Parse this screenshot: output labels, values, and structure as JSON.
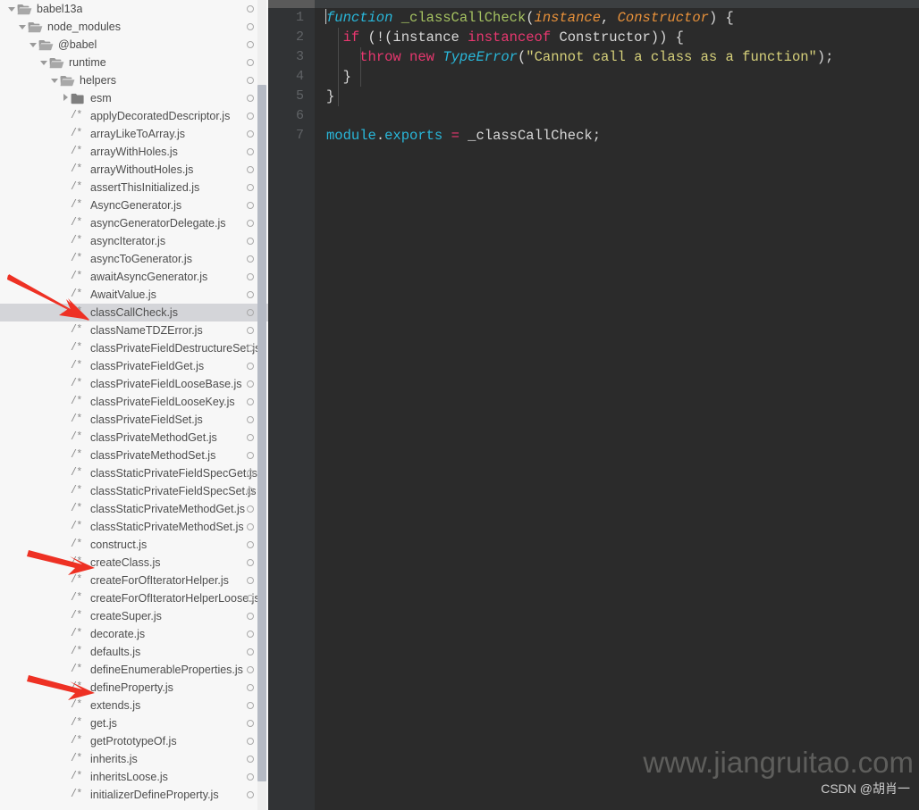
{
  "sidebar": {
    "scrollbar": {
      "name": "vertical-scrollbar"
    },
    "tree": [
      {
        "type": "folder",
        "depth": 1,
        "label": "babel13a",
        "expanded": true,
        "marker": "circle"
      },
      {
        "type": "folder",
        "depth": 2,
        "label": "node_modules",
        "expanded": true,
        "marker": "circle"
      },
      {
        "type": "folder",
        "depth": 3,
        "label": "@babel",
        "expanded": true,
        "marker": "circle"
      },
      {
        "type": "folder",
        "depth": 4,
        "label": "runtime",
        "expanded": true,
        "marker": "circle"
      },
      {
        "type": "folder",
        "depth": 5,
        "label": "helpers",
        "expanded": true,
        "marker": "circle"
      },
      {
        "type": "folder",
        "depth": 6,
        "label": "esm",
        "expanded": false,
        "marker": "circle",
        "closed": true
      },
      {
        "type": "file",
        "depth": 6,
        "label": "applyDecoratedDescriptor.js",
        "marker": "circle"
      },
      {
        "type": "file",
        "depth": 6,
        "label": "arrayLikeToArray.js",
        "marker": "circle"
      },
      {
        "type": "file",
        "depth": 6,
        "label": "arrayWithHoles.js",
        "marker": "circle"
      },
      {
        "type": "file",
        "depth": 6,
        "label": "arrayWithoutHoles.js",
        "marker": "circle"
      },
      {
        "type": "file",
        "depth": 6,
        "label": "assertThisInitialized.js",
        "marker": "circle"
      },
      {
        "type": "file",
        "depth": 6,
        "label": "AsyncGenerator.js",
        "marker": "circle"
      },
      {
        "type": "file",
        "depth": 6,
        "label": "asyncGeneratorDelegate.js",
        "marker": "circle"
      },
      {
        "type": "file",
        "depth": 6,
        "label": "asyncIterator.js",
        "marker": "circle"
      },
      {
        "type": "file",
        "depth": 6,
        "label": "asyncToGenerator.js",
        "marker": "circle"
      },
      {
        "type": "file",
        "depth": 6,
        "label": "awaitAsyncGenerator.js",
        "marker": "circle"
      },
      {
        "type": "file",
        "depth": 6,
        "label": "AwaitValue.js",
        "marker": "circle"
      },
      {
        "type": "file",
        "depth": 6,
        "label": "classCallCheck.js",
        "marker": "circle",
        "selected": true
      },
      {
        "type": "file",
        "depth": 6,
        "label": "classNameTDZError.js",
        "marker": "circle"
      },
      {
        "type": "file",
        "depth": 6,
        "label": "classPrivateFieldDestructureSet.js",
        "marker": "circle"
      },
      {
        "type": "file",
        "depth": 6,
        "label": "classPrivateFieldGet.js",
        "marker": "circle"
      },
      {
        "type": "file",
        "depth": 6,
        "label": "classPrivateFieldLooseBase.js",
        "marker": "circle"
      },
      {
        "type": "file",
        "depth": 6,
        "label": "classPrivateFieldLooseKey.js",
        "marker": "circle"
      },
      {
        "type": "file",
        "depth": 6,
        "label": "classPrivateFieldSet.js",
        "marker": "circle"
      },
      {
        "type": "file",
        "depth": 6,
        "label": "classPrivateMethodGet.js",
        "marker": "circle"
      },
      {
        "type": "file",
        "depth": 6,
        "label": "classPrivateMethodSet.js",
        "marker": "circle"
      },
      {
        "type": "file",
        "depth": 6,
        "label": "classStaticPrivateFieldSpecGet.js",
        "marker": "circle"
      },
      {
        "type": "file",
        "depth": 6,
        "label": "classStaticPrivateFieldSpecSet.js",
        "marker": "circle"
      },
      {
        "type": "file",
        "depth": 6,
        "label": "classStaticPrivateMethodGet.js",
        "marker": "circle"
      },
      {
        "type": "file",
        "depth": 6,
        "label": "classStaticPrivateMethodSet.js",
        "marker": "circle"
      },
      {
        "type": "file",
        "depth": 6,
        "label": "construct.js",
        "marker": "circle"
      },
      {
        "type": "file",
        "depth": 6,
        "label": "createClass.js",
        "marker": "circle"
      },
      {
        "type": "file",
        "depth": 6,
        "label": "createForOfIteratorHelper.js",
        "marker": "circle"
      },
      {
        "type": "file",
        "depth": 6,
        "label": "createForOfIteratorHelperLoose.js",
        "marker": "circle"
      },
      {
        "type": "file",
        "depth": 6,
        "label": "createSuper.js",
        "marker": "circle"
      },
      {
        "type": "file",
        "depth": 6,
        "label": "decorate.js",
        "marker": "circle"
      },
      {
        "type": "file",
        "depth": 6,
        "label": "defaults.js",
        "marker": "circle"
      },
      {
        "type": "file",
        "depth": 6,
        "label": "defineEnumerableProperties.js",
        "marker": "circle"
      },
      {
        "type": "file",
        "depth": 6,
        "label": "defineProperty.js",
        "marker": "circle"
      },
      {
        "type": "file",
        "depth": 6,
        "label": "extends.js",
        "marker": "circle"
      },
      {
        "type": "file",
        "depth": 6,
        "label": "get.js",
        "marker": "circle"
      },
      {
        "type": "file",
        "depth": 6,
        "label": "getPrototypeOf.js",
        "marker": "circle"
      },
      {
        "type": "file",
        "depth": 6,
        "label": "inherits.js",
        "marker": "circle"
      },
      {
        "type": "file",
        "depth": 6,
        "label": "inheritsLoose.js",
        "marker": "circle"
      },
      {
        "type": "file",
        "depth": 6,
        "label": "initializerDefineProperty.js",
        "marker": "circle"
      }
    ],
    "file_icon_glyph": "/*",
    "annotations": [
      {
        "name": "arrow-to-classCallCheck",
        "target": "classCallCheck.js"
      },
      {
        "name": "arrow-to-createClass",
        "target": "createClass.js"
      },
      {
        "name": "arrow-to-defineProperty",
        "target": "defineProperty.js"
      }
    ]
  },
  "editor": {
    "line_numbers": [
      "1",
      "2",
      "3",
      "4",
      "5",
      "6",
      "7"
    ],
    "lines": [
      {
        "n": "1",
        "tokens": [
          {
            "t": "caret",
            "v": ""
          },
          {
            "t": "cyan",
            "v": "function"
          },
          {
            "t": "pl",
            "v": " "
          },
          {
            "t": "fn",
            "v": "_classCallCheck"
          },
          {
            "t": "pl",
            "v": "("
          },
          {
            "t": "param",
            "v": "instance"
          },
          {
            "t": "pl",
            "v": ", "
          },
          {
            "t": "param",
            "v": "Constructor"
          },
          {
            "t": "pl",
            "v": ") {"
          }
        ]
      },
      {
        "n": "2",
        "tokens": [
          {
            "t": "pl",
            "v": "  "
          },
          {
            "t": "kw2",
            "v": "if"
          },
          {
            "t": "pl",
            "v": " (!(instance "
          },
          {
            "t": "kw2",
            "v": "instanceof"
          },
          {
            "t": "pl",
            "v": " Constructor)) {"
          }
        ]
      },
      {
        "n": "3",
        "tokens": [
          {
            "t": "pl",
            "v": "    "
          },
          {
            "t": "kw2",
            "v": "throw"
          },
          {
            "t": "pl",
            "v": " "
          },
          {
            "t": "kw2",
            "v": "new"
          },
          {
            "t": "pl",
            "v": " "
          },
          {
            "t": "cyan",
            "v": "TypeError"
          },
          {
            "t": "pl",
            "v": "("
          },
          {
            "t": "str",
            "v": "\"Cannot call a class as a function\""
          },
          {
            "t": "pl",
            "v": ");"
          }
        ]
      },
      {
        "n": "4",
        "tokens": [
          {
            "t": "pl",
            "v": "  }"
          }
        ]
      },
      {
        "n": "5",
        "tokens": [
          {
            "t": "pl",
            "v": "}"
          }
        ]
      },
      {
        "n": "6",
        "tokens": [
          {
            "t": "pl",
            "v": ""
          }
        ]
      },
      {
        "n": "7",
        "tokens": [
          {
            "t": "cyan-n",
            "v": "module"
          },
          {
            "t": "pl",
            "v": "."
          },
          {
            "t": "cyan-n",
            "v": "exports"
          },
          {
            "t": "pl",
            "v": " "
          },
          {
            "t": "op",
            "v": "="
          },
          {
            "t": "pl",
            "v": " _classCallCheck;"
          }
        ]
      }
    ],
    "watermark": "www.jiangruitao.com",
    "csdn_mark": "CSDN @胡肖一"
  },
  "colors": {
    "sidebar_bg": "#f7f7f7",
    "selection_bg": "#d4d5d9",
    "editor_bg": "#2b2b2b",
    "gutter_bg": "#313335",
    "arrow_red": "#ee3124",
    "keyword_pink": "#e8376f",
    "cyan": "#29b8db",
    "function_green": "#a5c261",
    "param_orange": "#e8913a",
    "string_yellow": "#d6d07a",
    "plain_text": "#d8d8d8"
  }
}
